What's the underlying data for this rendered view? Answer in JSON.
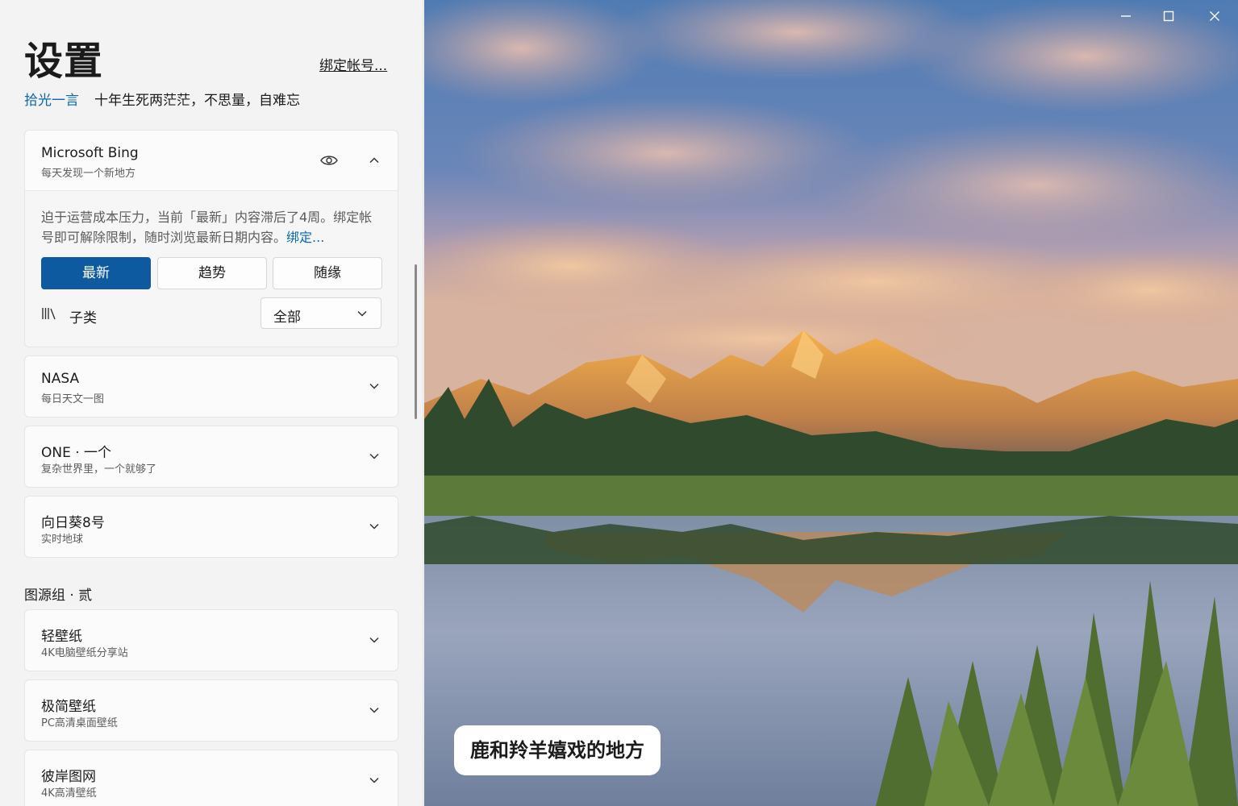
{
  "header": {
    "title": "设置",
    "bind_link": "绑定帐号..."
  },
  "quote": {
    "source": "拾光一言",
    "text": "十年生死两茫茫，不思量，自难忘"
  },
  "bing": {
    "title": "Microsoft Bing",
    "subtitle": "每天发现一个新地方",
    "notice": "迫于运营成本压力，当前「最新」内容滞后了4周。绑定帐号即可解除限制，随时浏览最新日期内容。",
    "notice_link": "绑定...",
    "tabs": [
      {
        "label": "最新",
        "active": true
      },
      {
        "label": "趋势",
        "active": false
      },
      {
        "label": "随缘",
        "active": false
      }
    ],
    "subcategory_label": "子类",
    "subcategory_value": "全部"
  },
  "sources_group1": [
    {
      "title": "NASA",
      "subtitle": "每日天文一图"
    },
    {
      "title": "ONE · 一个",
      "subtitle": "复杂世界里，一个就够了"
    },
    {
      "title": "向日葵8号",
      "subtitle": "实时地球"
    }
  ],
  "group2_heading": "图源组 · 贰",
  "sources_group2": [
    {
      "title": "轻壁纸",
      "subtitle": "4K电脑壁纸分享站"
    },
    {
      "title": "极简壁纸",
      "subtitle": "PC高清桌面壁纸"
    },
    {
      "title": "彼岸图网",
      "subtitle": "4K高清壁纸"
    }
  ],
  "photo": {
    "caption": "鹿和羚羊嬉戏的地方"
  },
  "colors": {
    "accent": "#0e5aa0",
    "link": "#0a68b0",
    "panel_bg": "#f3f3f3",
    "card_bg": "#fbfbfb"
  },
  "icons": [
    "eye-icon",
    "chevron-up-icon",
    "chevron-down-icon",
    "library-icon",
    "minimize-icon",
    "maximize-icon",
    "close-icon"
  ]
}
